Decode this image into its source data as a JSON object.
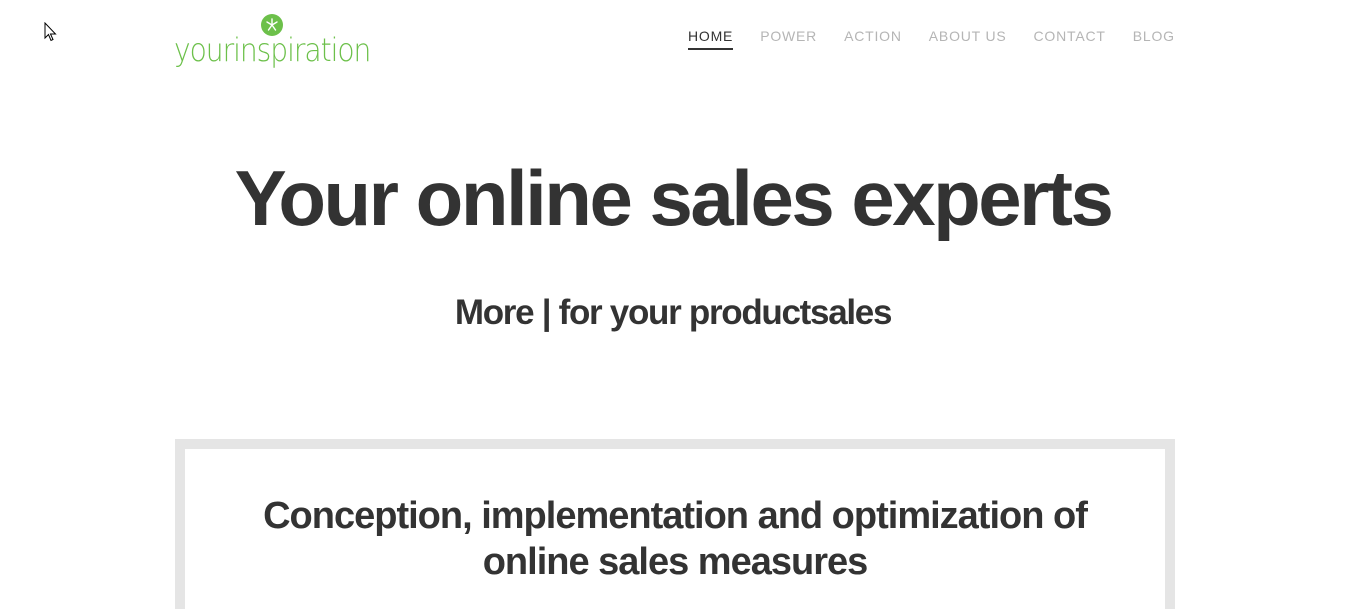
{
  "brand": {
    "logo_text": "yourinspiration",
    "accent_color": "#6cc04a",
    "logo_icon": "clover-icon"
  },
  "nav": {
    "items": [
      {
        "label": "HOME",
        "active": true
      },
      {
        "label": "POWER",
        "active": false
      },
      {
        "label": "ACTION",
        "active": false
      },
      {
        "label": "ABOUT US",
        "active": false
      },
      {
        "label": "CONTACT",
        "active": false
      },
      {
        "label": "BLOG",
        "active": false
      }
    ]
  },
  "hero": {
    "title": "Your online sales experts",
    "subtitle": "More | for your productsales"
  },
  "feature_box": {
    "title": "Conception, implementation and optimization of online sales measures"
  },
  "colors": {
    "text": "#333333",
    "nav_inactive": "#b5b5b5",
    "box_border": "#e5e5e5"
  }
}
